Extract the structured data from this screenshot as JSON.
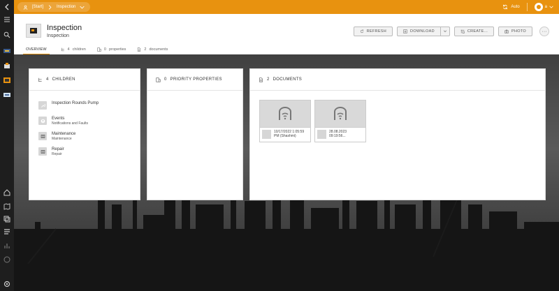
{
  "topbar": {
    "breadcrumb_start": "[Start]",
    "breadcrumb_current": "Inspection",
    "auto_label": "Auto",
    "user_initial": "a",
    "accent": "#e8920f"
  },
  "header": {
    "title": "Inspection",
    "subtitle": "Inspection",
    "buttons": {
      "refresh": "REFRESH",
      "download": "DOWNLOAD",
      "create": "CREATE...",
      "photo": "PHOTO"
    },
    "more": "···",
    "tabs": {
      "overview": "OVERVIEW",
      "children_count": "4",
      "children_label": "children",
      "properties_count": "0",
      "properties_label": "properties",
      "documents_count": "2",
      "documents_label": "documents"
    }
  },
  "cards": {
    "children": {
      "count": "4",
      "label": "CHILDREN",
      "items": [
        {
          "title": "Inspection Rounds Pump",
          "sub": ""
        },
        {
          "title": "Events",
          "sub": "Notifications and Faults"
        },
        {
          "title": "Maintenance",
          "sub": "Maintenance"
        },
        {
          "title": "Repair",
          "sub": "Repair"
        }
      ]
    },
    "priority": {
      "count": "0",
      "label": "PRIORITY PROPERTIES"
    },
    "documents": {
      "count": "2",
      "label": "DOCUMENTS",
      "items": [
        {
          "line1": "10/17/2022 1:05:59",
          "line2": "PM (Shashmi)"
        },
        {
          "line1": "28.08.2023",
          "line2": "09:19:56..."
        }
      ]
    }
  }
}
